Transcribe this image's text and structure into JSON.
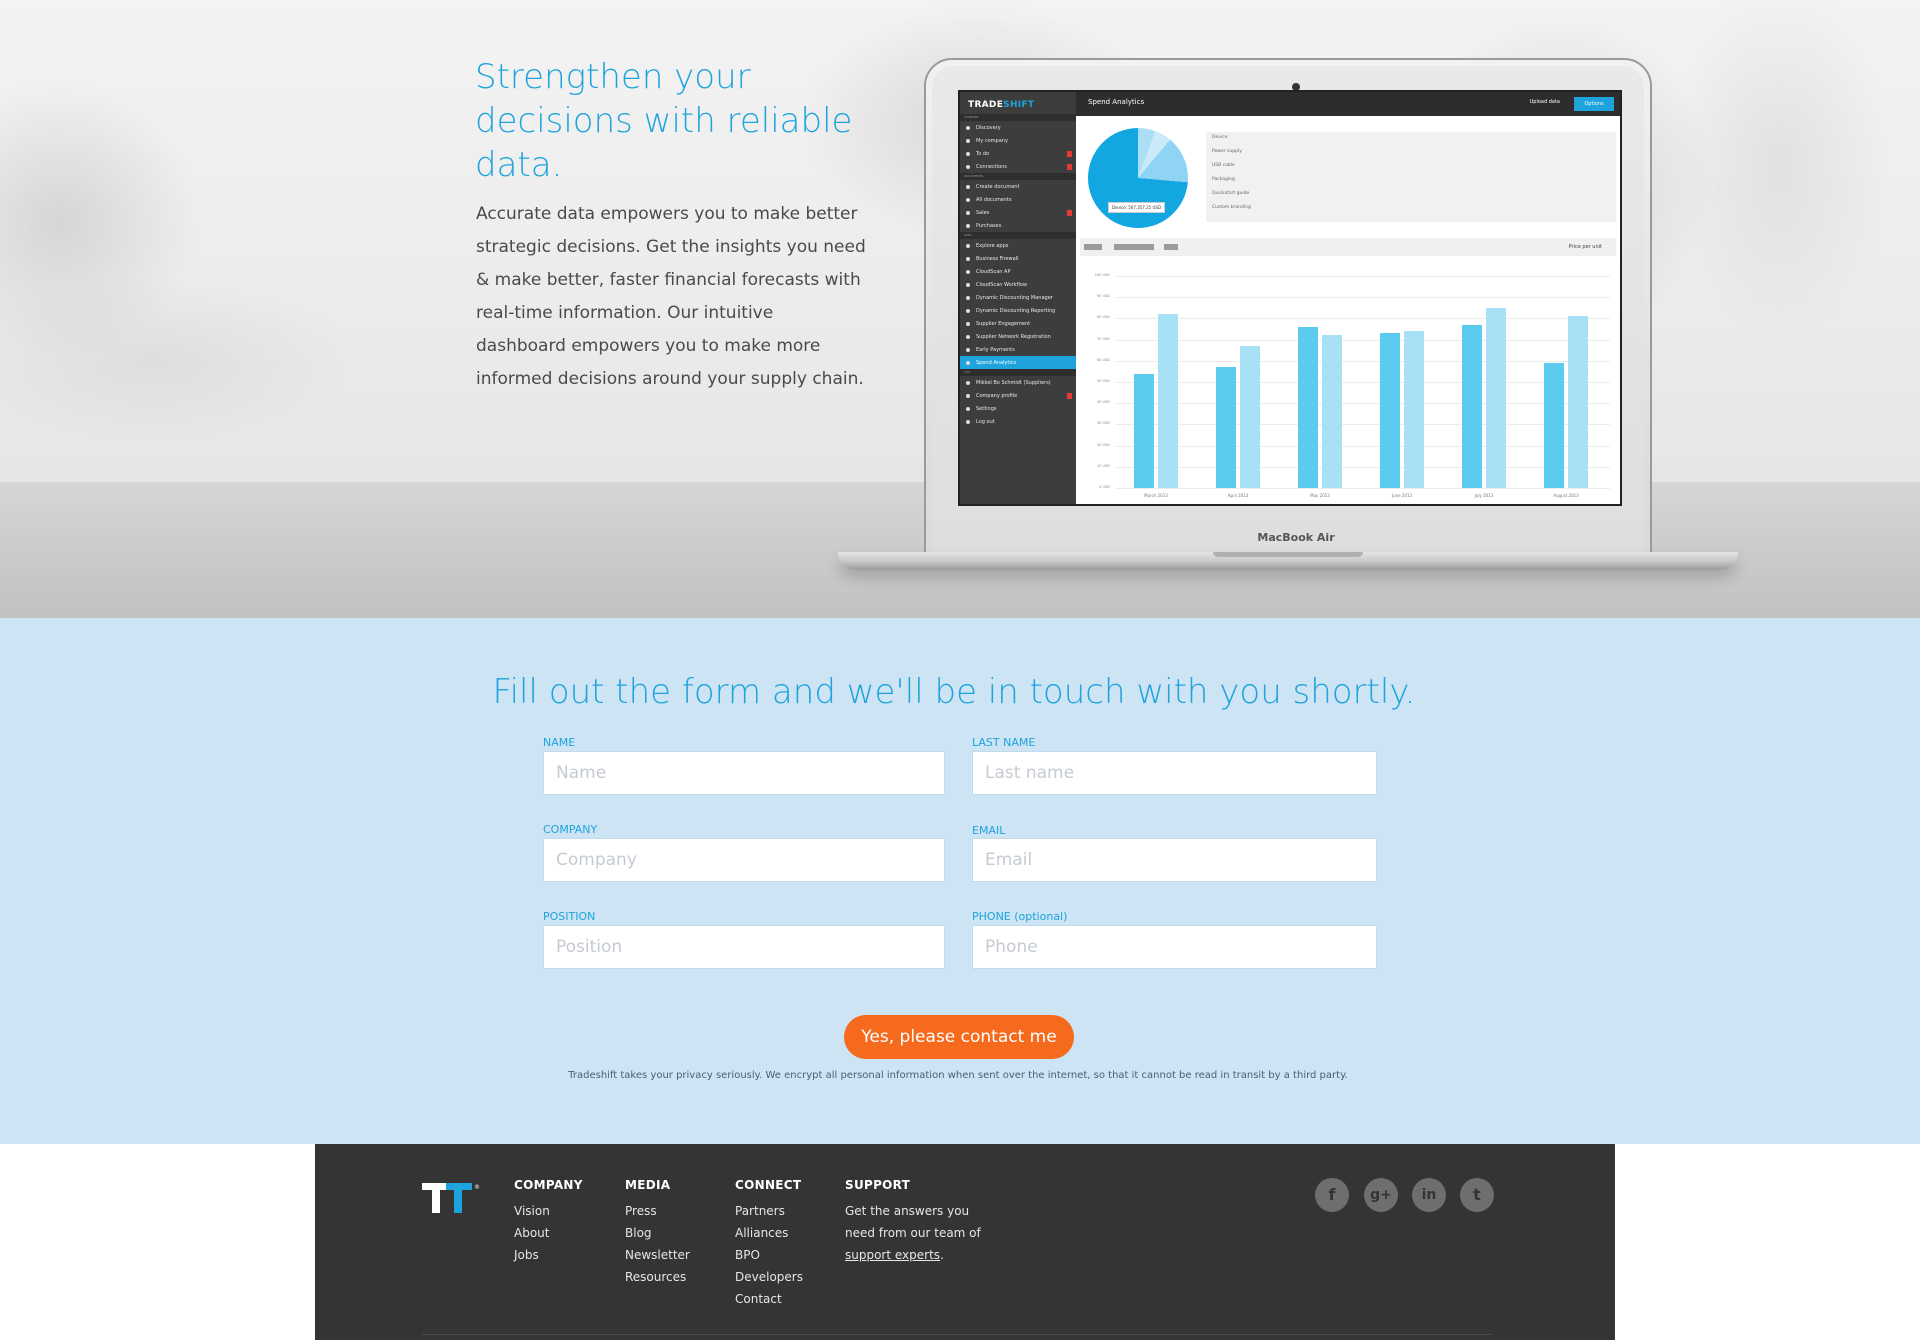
{
  "hero": {
    "title": "Strengthen your decisions with reliable data.",
    "body": "Accurate data empowers you to make better strategic decisions. Get the insights you need & make better, faster financial forecasts with real-time information. Our intuitive dashboard empowers you to make more informed decisions around your supply chain.",
    "laptop_brand": "MacBook Air"
  },
  "app_screen": {
    "logo_main": "TRADE",
    "logo_accent": "SHIFT",
    "page_title": "Spend Analytics",
    "upload_label": "Upload data",
    "options_label": "Options",
    "pie_label": "Device: 567,357.25 USD",
    "sidebar": {
      "section_company": "COMPANY",
      "section_documents": "DOCUMENTS",
      "section_apps": "APPS",
      "section_you": "YOU",
      "items": [
        "Discovery",
        "My company",
        "To do",
        "Connections",
        "Create document",
        "All documents",
        "Sales",
        "Purchases",
        "Explore apps",
        "Business Firewall",
        "CloudScan AP",
        "CloudScan Workflow",
        "Dynamic Discounting Manager",
        "Dynamic Discounting Reporting",
        "Supplier Engagement",
        "Supplier Network Registration",
        "Early Payments",
        "Spend Analytics",
        "Mikkel Bo Schmidt (Suppliers)",
        "Company profile",
        "Settings",
        "Log out"
      ]
    },
    "list_rows": [
      "Device",
      "Power supply",
      "USB cable",
      "Packaging",
      "Quickstart guide",
      "Custom branding"
    ],
    "price_label": "Price per unit",
    "chart": {
      "y_ticks": [
        "100 USD",
        "90 USD",
        "80 USD",
        "70 USD",
        "60 USD",
        "50 USD",
        "40 USD",
        "30 USD",
        "20 USD",
        "10 USD",
        "0 USD"
      ],
      "months": [
        "March 2013",
        "April 2013",
        "May 2013",
        "June 2013",
        "July 2013",
        "August 2013"
      ],
      "series_a": [
        54,
        57,
        76,
        73,
        77,
        59
      ],
      "series_b": [
        82,
        67,
        72,
        74,
        85,
        81
      ]
    }
  },
  "form": {
    "title": "Fill out the form and we'll be in touch with you shortly.",
    "name_label": "NAME",
    "name_placeholder": "Name",
    "last_name_label": "LAST NAME",
    "last_name_placeholder": "Last name",
    "company_label": "COMPANY",
    "company_placeholder": "Company",
    "email_label": "EMAIL",
    "email_placeholder": "Email",
    "position_label": "POSITION",
    "position_placeholder": "Position",
    "phone_label": "PHONE (optional)",
    "phone_placeholder": "Phone",
    "submit_label": "Yes, please contact me",
    "privacy": "Tradeshift takes your privacy seriously. We encrypt all personal information when sent over the internet, so that it cannot be read in transit by a third party."
  },
  "footer": {
    "company": {
      "heading": "COMPANY",
      "links": [
        "Vision",
        "About",
        "Jobs"
      ]
    },
    "media": {
      "heading": "MEDIA",
      "links": [
        "Press",
        "Blog",
        "Newsletter",
        "Resources"
      ]
    },
    "connect": {
      "heading": "CONNECT",
      "links": [
        "Partners",
        "Alliances",
        "BPO",
        "Developers",
        "Contact"
      ]
    },
    "support": {
      "heading": "SUPPORT",
      "text_before": "Get the answers you need from our team of ",
      "link": "support experts",
      "text_after": "."
    },
    "social": {
      "facebook": "f",
      "google_plus": "g+",
      "linkedin": "in",
      "twitter": "t"
    },
    "logo_mark": "®"
  },
  "colors": {
    "accent_blue": "#1ea3dc",
    "cta_orange": "#f56a1d",
    "form_bg": "#cde4f5",
    "footer_bg": "#343434"
  },
  "icons": [
    "facebook-icon",
    "google-plus-icon",
    "linkedin-icon",
    "twitter-icon",
    "tradeshift-logo-icon"
  ]
}
